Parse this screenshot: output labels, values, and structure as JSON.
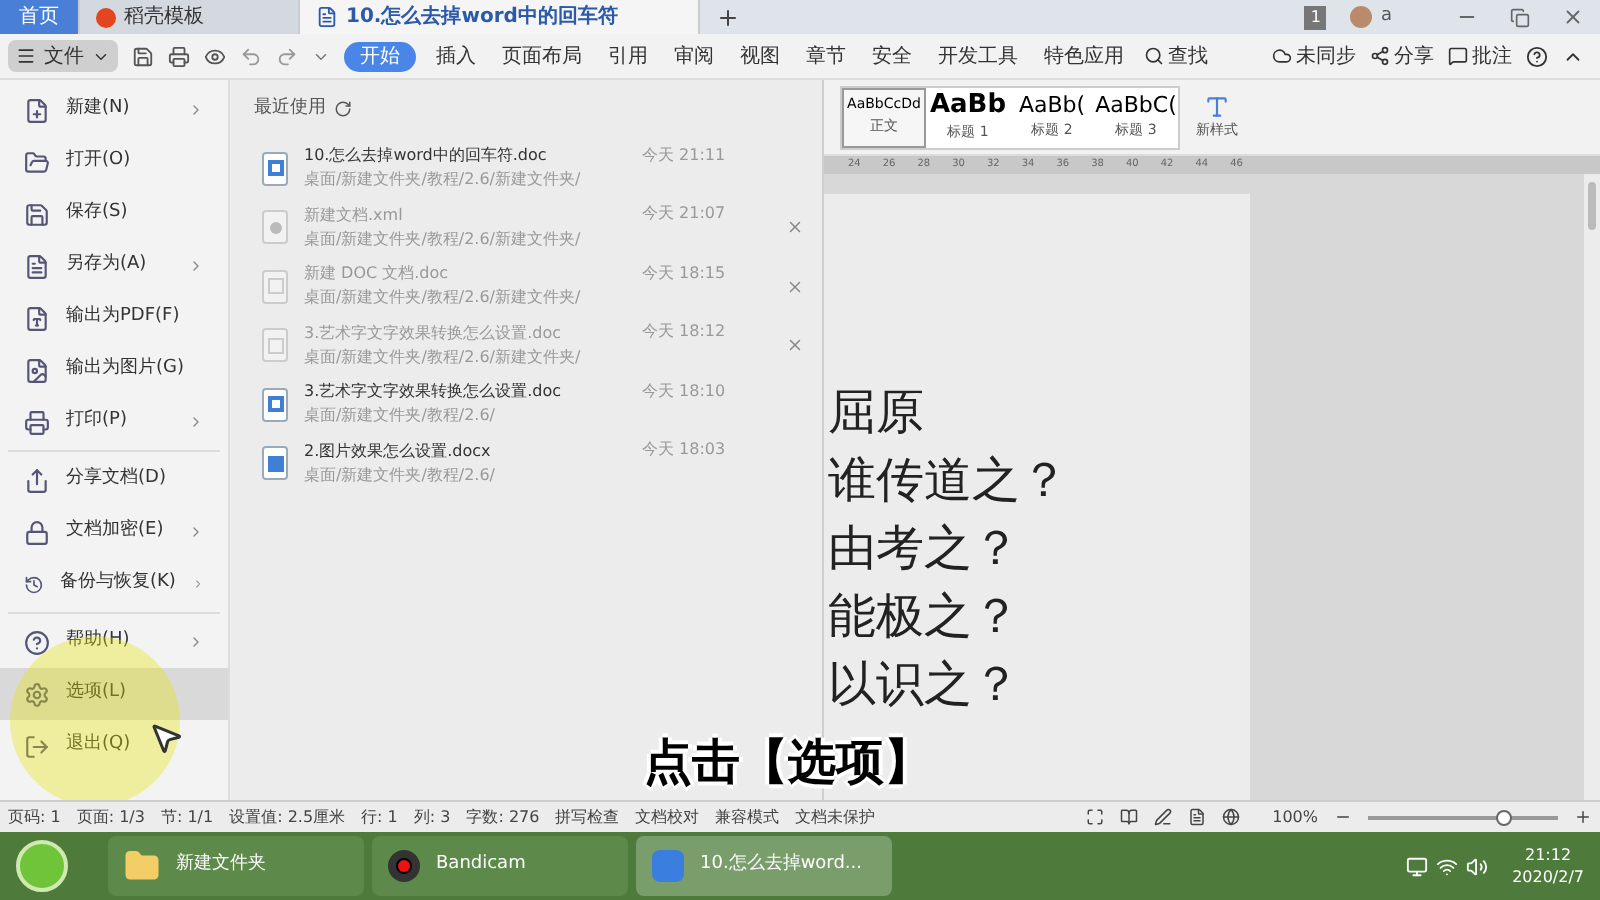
{
  "tabs": [
    {
      "label": "首页",
      "kind": "home",
      "selected": false
    },
    {
      "label": "稻壳模板",
      "kind": "template",
      "selected": false
    },
    {
      "label": "10.怎么去掉word中的回车符",
      "kind": "doc",
      "selected": true
    }
  ],
  "account": {
    "badge": "1",
    "name": "a"
  },
  "file_button": {
    "label": "文件"
  },
  "ribbon_tabs": [
    {
      "label": "开始",
      "selected": true
    },
    {
      "label": "插入",
      "selected": false
    },
    {
      "label": "页面布局",
      "selected": false
    },
    {
      "label": "引用",
      "selected": false
    },
    {
      "label": "审阅",
      "selected": false
    },
    {
      "label": "视图",
      "selected": false
    },
    {
      "label": "章节",
      "selected": false
    },
    {
      "label": "安全",
      "selected": false
    },
    {
      "label": "开发工具",
      "selected": false
    },
    {
      "label": "特色应用",
      "selected": false
    }
  ],
  "search": {
    "label": "查找"
  },
  "top_actions": [
    "未同步",
    "分享",
    "批注"
  ],
  "styles": [
    {
      "sample": "AaBbCcDd",
      "label": "正文",
      "selected": true
    },
    {
      "sample": "AaBb",
      "label": "标题 1",
      "selected": false
    },
    {
      "sample": "AaBb(",
      "label": "标题 2",
      "selected": false
    },
    {
      "sample": "AaBbC(",
      "label": "标题 3",
      "selected": false
    }
  ],
  "new_style": {
    "label": "新样式"
  },
  "ruler": [
    "24",
    "26",
    "28",
    "30",
    "32",
    "34",
    "36",
    "38",
    "40",
    "42",
    "44",
    "46"
  ],
  "file_menu": [
    {
      "items": [
        {
          "label": "新建(N)",
          "submenu": true,
          "selected": false
        },
        {
          "label": "打开(O)",
          "submenu": false,
          "selected": false
        },
        {
          "label": "保存(S)",
          "submenu": false,
          "selected": false
        },
        {
          "label": "另存为(A)",
          "submenu": true,
          "selected": false
        },
        {
          "label": "输出为PDF(F)",
          "submenu": false,
          "selected": false
        },
        {
          "label": "输出为图片(G)",
          "submenu": false,
          "selected": false
        },
        {
          "label": "打印(P)",
          "submenu": true,
          "selected": false
        }
      ]
    },
    {
      "items": [
        {
          "label": "分享文档(D)",
          "submenu": false,
          "selected": false
        },
        {
          "label": "文档加密(E)",
          "submenu": true,
          "selected": false
        },
        {
          "label": "备份与恢复(K)",
          "submenu": true,
          "selected": false
        }
      ]
    },
    {
      "items": [
        {
          "label": "帮助(H)",
          "submenu": true,
          "selected": false
        },
        {
          "label": "选项(L)",
          "submenu": false,
          "selected": true
        },
        {
          "label": "退出(Q)",
          "submenu": false,
          "selected": false
        }
      ]
    }
  ],
  "recent": {
    "title": "最近使用",
    "files": [
      {
        "name": "10.怎么去掉word中的回车符.doc",
        "path": "桌面/新建文件夹/教程/2.6/新建文件夹/",
        "time": "今天 21:11",
        "kind": "word",
        "available": true,
        "removable": false
      },
      {
        "name": "新建文档.xml",
        "path": "桌面/新建文件夹/教程/2.6/新建文件夹/",
        "time": "今天 21:07",
        "kind": "xml",
        "available": false,
        "removable": true
      },
      {
        "name": "新建 DOC 文档.doc",
        "path": "桌面/新建文件夹/教程/2.6/新建文件夹/",
        "time": "今天 18:15",
        "kind": "word",
        "available": false,
        "removable": true
      },
      {
        "name": "3.艺术字文字效果转换怎么设置.doc",
        "path": "桌面/新建文件夹/教程/2.6/新建文件夹/",
        "time": "今天 18:12",
        "kind": "word",
        "available": false,
        "removable": true
      },
      {
        "name": "3.艺术字文字效果转换怎么设置.doc",
        "path": "桌面/新建文件夹/教程/2.6/",
        "time": "今天 18:10",
        "kind": "word",
        "available": true,
        "removable": false
      },
      {
        "name": "2.图片效果怎么设置.docx",
        "path": "桌面/新建文件夹/教程/2.6/",
        "time": "今天 18:03",
        "kind": "docx",
        "available": true,
        "removable": false
      }
    ]
  },
  "document": {
    "lines": [
      "屈原",
      "谁传道之？",
      "由考之？",
      "能极之？",
      "以识之？"
    ]
  },
  "caption": "点击【选项】",
  "status_bar": {
    "items": [
      "页码: 1",
      "页面: 1/3",
      "节: 1/1",
      "设置值: 2.5厘米",
      "行: 1",
      "列: 3",
      "字数: 276"
    ],
    "tools": [
      "拼写检查",
      "文档校对",
      "兼容模式",
      "文档未保护"
    ],
    "zoom": "100%",
    "zoom_level": {
      "level": 0.72
    }
  },
  "taskbar": {
    "apps": [
      {
        "label": "新建文件夹",
        "kind": "folder",
        "selected": false
      },
      {
        "label": "Bandicam",
        "kind": "record",
        "selected": false
      },
      {
        "label": "10.怎么去掉word...",
        "kind": "wps",
        "selected": true
      }
    ],
    "time": "21:12",
    "date": "2020/2/7"
  }
}
